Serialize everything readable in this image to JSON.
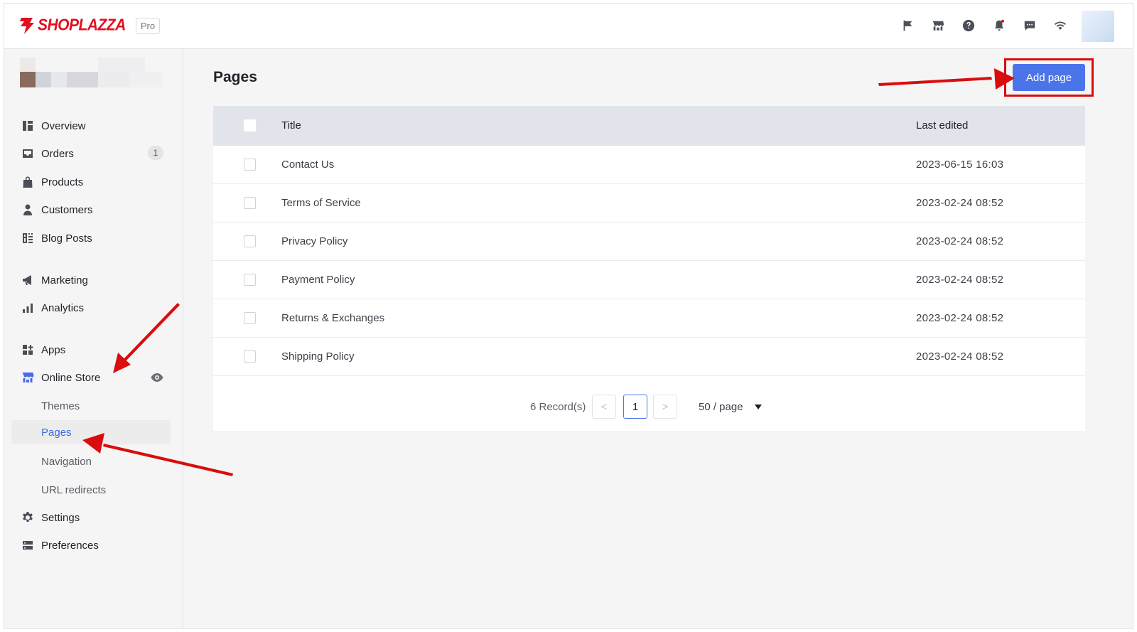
{
  "brand": {
    "name": "SHOPLAZZA",
    "plan_badge": "Pro"
  },
  "topbar_icons": [
    "flag-icon",
    "storefront-icon",
    "help-icon",
    "notification-bell-icon",
    "messages-icon",
    "wifi-icon"
  ],
  "sidebar": {
    "items": [
      {
        "id": "overview",
        "label": "Overview"
      },
      {
        "id": "orders",
        "label": "Orders",
        "badge": "1"
      },
      {
        "id": "products",
        "label": "Products"
      },
      {
        "id": "customers",
        "label": "Customers"
      },
      {
        "id": "blog-posts",
        "label": "Blog Posts"
      },
      {
        "id": "marketing",
        "label": "Marketing"
      },
      {
        "id": "analytics",
        "label": "Analytics"
      },
      {
        "id": "apps",
        "label": "Apps"
      },
      {
        "id": "online-store",
        "label": "Online Store"
      },
      {
        "id": "themes",
        "label": "Themes"
      },
      {
        "id": "pages",
        "label": "Pages",
        "active": true
      },
      {
        "id": "navigation",
        "label": "Navigation"
      },
      {
        "id": "url-redirects",
        "label": "URL redirects"
      },
      {
        "id": "settings",
        "label": "Settings"
      },
      {
        "id": "preferences",
        "label": "Preferences"
      }
    ]
  },
  "main": {
    "title": "Pages",
    "add_button": "Add page",
    "table": {
      "headers": {
        "title": "Title",
        "last_edited": "Last edited"
      },
      "rows": [
        {
          "title": "Contact Us",
          "last_edited": "2023-06-15 16:03"
        },
        {
          "title": "Terms of Service",
          "last_edited": "2023-02-24 08:52"
        },
        {
          "title": "Privacy Policy",
          "last_edited": "2023-02-24 08:52"
        },
        {
          "title": "Payment Policy",
          "last_edited": "2023-02-24 08:52"
        },
        {
          "title": "Returns & Exchanges",
          "last_edited": "2023-02-24 08:52"
        },
        {
          "title": "Shipping Policy",
          "last_edited": "2023-02-24 08:52"
        }
      ]
    },
    "pagination": {
      "records": "6 Record(s)",
      "prev": "<",
      "current_page": "1",
      "next": ">",
      "per_page": "50 / page"
    }
  },
  "colors": {
    "brand_red": "#e30f1f",
    "primary_button": "#4b74ea",
    "active_nav_text": "#3a68de",
    "annotation_red": "#d90d0d"
  }
}
